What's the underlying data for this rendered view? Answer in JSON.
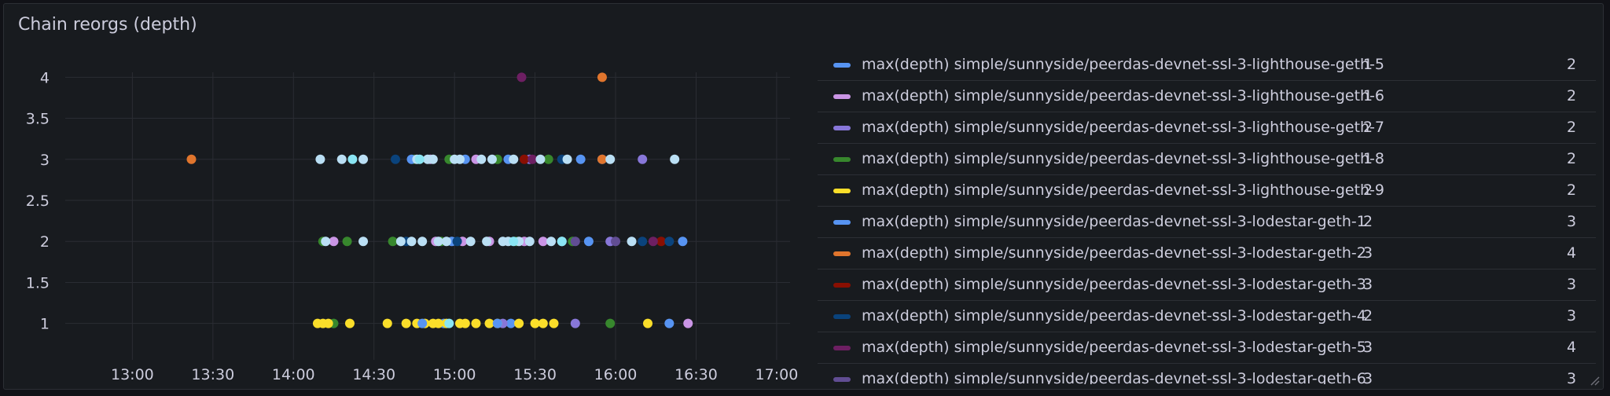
{
  "panel": {
    "title": "Chain reorgs (depth)"
  },
  "chart_data": {
    "type": "scatter",
    "title": "Chain reorgs (depth)",
    "xlabel": "",
    "ylabel": "",
    "x_ticks": [
      "13:00",
      "13:30",
      "14:00",
      "14:30",
      "15:00",
      "15:30",
      "16:00",
      "16:30",
      "17:00"
    ],
    "y_ticks": [
      "1",
      "1.5",
      "2",
      "2.5",
      "3",
      "3.5",
      "4"
    ],
    "ylim": [
      0.7,
      4.3
    ],
    "xlim": [
      "12:35",
      "17:05"
    ],
    "grid": true,
    "legend_position": "right",
    "legend_columns": [
      "",
      "",
      ""
    ],
    "series": [
      {
        "name": "max(depth) simple/sunnyside/peerdas-devnet-ssl-3-lighthouse-geth-5",
        "color": "#5794f2",
        "v1": "1",
        "v2": "2",
        "points": [
          [
            "14:56",
            1
          ],
          [
            "15:21",
            1
          ],
          [
            "15:55",
            3
          ],
          [
            "16:20",
            1
          ],
          [
            "16:25",
            2
          ]
        ]
      },
      {
        "name": "max(depth) simple/sunnyside/peerdas-devnet-ssl-3-lighthouse-geth-6",
        "color": "#ca95e5",
        "v1": "1",
        "v2": "2",
        "points": [
          [
            "14:15",
            2
          ],
          [
            "14:51",
            3
          ],
          [
            "14:53",
            2
          ],
          [
            "15:03",
            2
          ],
          [
            "15:08",
            3
          ],
          [
            "15:13",
            2
          ],
          [
            "15:26",
            2
          ],
          [
            "15:33",
            2
          ],
          [
            "16:27",
            1
          ]
        ]
      },
      {
        "name": "max(depth) simple/sunnyside/peerdas-devnet-ssl-3-lighthouse-geth-7",
        "color": "#8877d9",
        "v1": "2",
        "v2": "2",
        "points": [
          [
            "15:18",
            1
          ],
          [
            "15:28",
            3
          ],
          [
            "15:45",
            1
          ],
          [
            "15:58",
            2
          ],
          [
            "16:10",
            3
          ]
        ]
      },
      {
        "name": "max(depth) simple/sunnyside/peerdas-devnet-ssl-3-lighthouse-geth-8",
        "color": "#37872d",
        "v1": "1",
        "v2": "2",
        "points": [
          [
            "14:11",
            2
          ],
          [
            "14:15",
            1
          ],
          [
            "14:20",
            2
          ],
          [
            "14:37",
            2
          ],
          [
            "14:45",
            3
          ],
          [
            "14:55",
            2
          ],
          [
            "14:58",
            3
          ],
          [
            "15:16",
            3
          ],
          [
            "15:23",
            2
          ],
          [
            "15:35",
            3
          ],
          [
            "15:44",
            2
          ],
          [
            "15:58",
            1
          ]
        ]
      },
      {
        "name": "max(depth) simple/sunnyside/peerdas-devnet-ssl-3-lighthouse-geth-9",
        "color": "#fade2a",
        "v1": "2",
        "v2": "2",
        "points": [
          [
            "14:09",
            1
          ],
          [
            "14:11",
            1
          ],
          [
            "14:13",
            1
          ],
          [
            "14:21",
            1
          ],
          [
            "14:35",
            1
          ],
          [
            "14:42",
            1
          ],
          [
            "14:46",
            1
          ],
          [
            "14:49",
            1
          ],
          [
            "14:52",
            1
          ],
          [
            "14:54",
            1
          ],
          [
            "14:57",
            1
          ],
          [
            "15:02",
            1
          ],
          [
            "15:04",
            1
          ],
          [
            "15:08",
            1
          ],
          [
            "15:13",
            1
          ],
          [
            "15:16",
            1
          ],
          [
            "15:24",
            1
          ],
          [
            "15:30",
            1
          ],
          [
            "15:33",
            1
          ],
          [
            "15:37",
            1
          ],
          [
            "16:12",
            1
          ]
        ]
      },
      {
        "name": "max(depth) simple/sunnyside/peerdas-devnet-ssl-3-lodestar-geth-1",
        "color": "#5794f2",
        "v1": "2",
        "v2": "3",
        "points": [
          [
            "14:44",
            3
          ],
          [
            "14:48",
            1
          ],
          [
            "14:59",
            2
          ],
          [
            "15:04",
            3
          ],
          [
            "15:16",
            1
          ],
          [
            "15:20",
            3
          ],
          [
            "15:47",
            3
          ],
          [
            "15:50",
            2
          ]
        ]
      },
      {
        "name": "max(depth) simple/sunnyside/peerdas-devnet-ssl-3-lodestar-geth-2",
        "color": "#e0752d",
        "v1": "3",
        "v2": "4",
        "points": [
          [
            "13:22",
            3
          ],
          [
            "15:55",
            4
          ],
          [
            "15:55",
            3
          ]
        ]
      },
      {
        "name": "max(depth) simple/sunnyside/peerdas-devnet-ssl-3-lodestar-geth-3",
        "color": "#890f02",
        "v1": "3",
        "v2": "3",
        "points": [
          [
            "15:26",
            3
          ],
          [
            "16:17",
            2
          ]
        ]
      },
      {
        "name": "max(depth) simple/sunnyside/peerdas-devnet-ssl-3-lodestar-geth-4",
        "color": "#0a437c",
        "v1": "2",
        "v2": "3",
        "points": [
          [
            "14:38",
            3
          ],
          [
            "14:42",
            2
          ],
          [
            "15:01",
            2
          ],
          [
            "15:40",
            3
          ],
          [
            "16:10",
            2
          ],
          [
            "16:20",
            2
          ]
        ]
      },
      {
        "name": "max(depth) simple/sunnyside/peerdas-devnet-ssl-3-lodestar-geth-5",
        "color": "#6d1f62",
        "v1": "3",
        "v2": "4",
        "points": [
          [
            "15:25",
            4
          ],
          [
            "15:29",
            3
          ],
          [
            "16:14",
            2
          ]
        ]
      },
      {
        "name": "max(depth) simple/sunnyside/peerdas-devnet-ssl-3-lodestar-geth-6",
        "color": "#614d93",
        "v1": "3",
        "v2": "3",
        "points": [
          [
            "15:45",
            2
          ],
          [
            "16:00",
            2
          ]
        ]
      },
      {
        "name": "",
        "color": "#badff4",
        "v1": "",
        "v2": "",
        "points": [
          [
            "14:10",
            3
          ],
          [
            "14:12",
            2
          ],
          [
            "14:18",
            3
          ],
          [
            "14:26",
            3
          ],
          [
            "14:26",
            2
          ],
          [
            "14:40",
            2
          ],
          [
            "14:44",
            2
          ],
          [
            "14:46",
            3
          ],
          [
            "14:48",
            2
          ],
          [
            "14:50",
            3
          ],
          [
            "14:52",
            3
          ],
          [
            "14:54",
            2
          ],
          [
            "14:57",
            2
          ],
          [
            "15:00",
            3
          ],
          [
            "15:02",
            3
          ],
          [
            "15:06",
            2
          ],
          [
            "15:10",
            3
          ],
          [
            "15:12",
            2
          ],
          [
            "15:14",
            3
          ],
          [
            "15:18",
            2
          ],
          [
            "15:20",
            2
          ],
          [
            "15:22",
            3
          ],
          [
            "15:24",
            2
          ],
          [
            "15:28",
            2
          ],
          [
            "15:32",
            3
          ],
          [
            "15:36",
            2
          ],
          [
            "15:40",
            2
          ],
          [
            "15:42",
            3
          ],
          [
            "15:58",
            3
          ],
          [
            "16:06",
            2
          ],
          [
            "16:22",
            3
          ]
        ]
      },
      {
        "name": "",
        "color": "#8ae5f3",
        "v1": "",
        "v2": "",
        "points": [
          [
            "14:22",
            3
          ],
          [
            "14:47",
            3
          ],
          [
            "14:58",
            1
          ],
          [
            "15:22",
            2
          ],
          [
            "15:40",
            2
          ]
        ]
      }
    ]
  },
  "legend": {
    "visible_rows": 11
  }
}
